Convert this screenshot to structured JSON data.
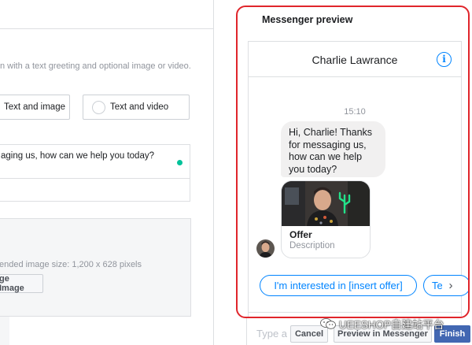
{
  "editor": {
    "description": "n with a text greeting and optional image or video.",
    "option_text_and_image": "Text and image",
    "option_text_and_video": "Text and video",
    "greeting_text": "aging us, how can we help you today?",
    "image_hint": "ended image size: 1,200 x 628 pixels",
    "change_image_label": "ge Image"
  },
  "preview": {
    "title": "Messenger preview",
    "contact_name": "Charlie Lawrance",
    "info_symbol": "i",
    "time": "15:10",
    "greeting_lines": [
      "Hi, Charlie! Thanks",
      "for messaging us,",
      "how can we help",
      "you today?"
    ],
    "card": {
      "title": "Offer",
      "description": "Description"
    },
    "quick_replies": [
      "I'm interested in [insert offer]",
      "Te"
    ],
    "more_arrow": "›",
    "composer_placeholder": "Type a"
  },
  "footer": {
    "cancel_label": "Cancel",
    "preview_label": "Preview in Messenger",
    "finish_label": "Finish"
  },
  "watermark": {
    "text": "UEESHOP自建站平台"
  },
  "colors": {
    "accent_blue": "#0084ff",
    "finish_blue": "#4267b2",
    "highlight_red": "#e0252b",
    "status_green": "#00c29a"
  },
  "icons": {
    "info": "info-circle-icon",
    "arrow": "chevron-right-icon",
    "radio": "radio-unchecked-icon",
    "watermark_logo": "wechat-icon"
  }
}
